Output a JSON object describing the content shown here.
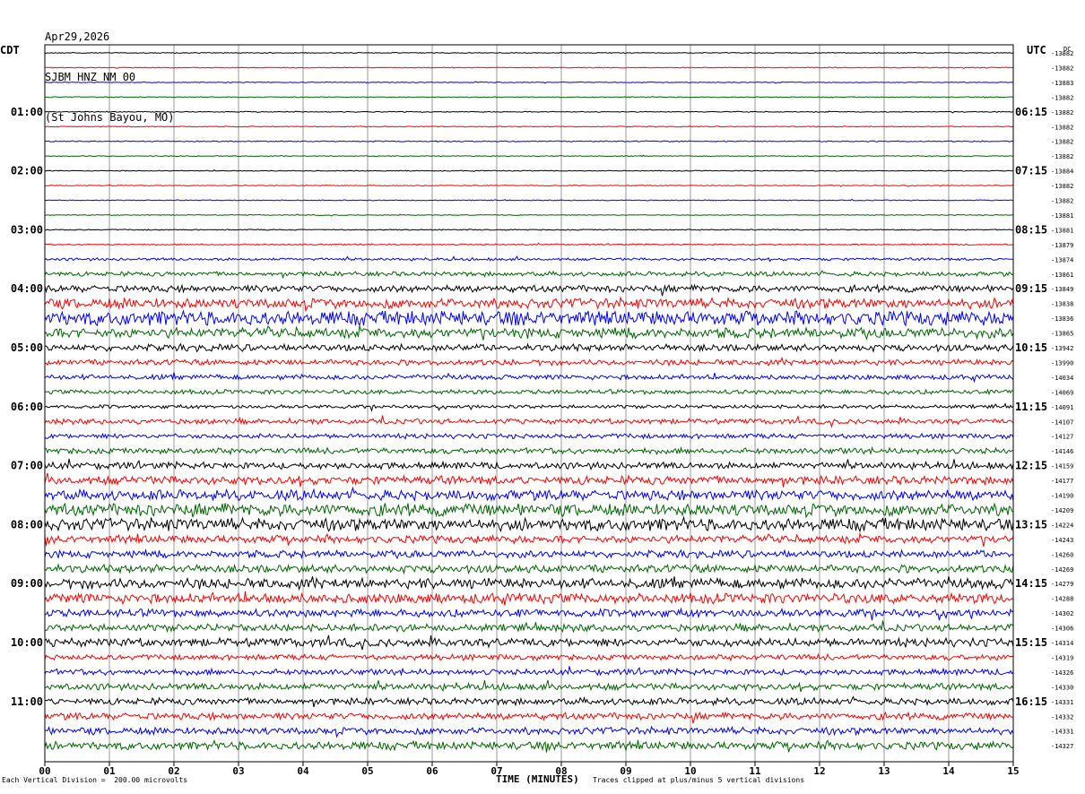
{
  "header": {
    "date": "Apr29,2026",
    "station": "SJBM HNZ NM 00",
    "location": "(St Johns Bayou, MO)"
  },
  "left_tz": "CDT",
  "right_tz": "UTC",
  "right_top_label": "DC",
  "footer": {
    "scale_note": "Each Vertical Division =  200.00 microvolts",
    "xlabel": "TIME (MINUTES)",
    "clip_note": "Traces clipped at plus/minus 5 vertical divisions"
  },
  "colors": {
    "black": "#000000",
    "red": "#ff0000",
    "blue": "#0000ff",
    "green": "#006600",
    "grid": "#808080"
  },
  "chart_data": {
    "type": "line",
    "title": "SJBM HNZ NM 00",
    "xlabel": "TIME (MINUTES)",
    "xlim": [
      0,
      15
    ],
    "x_ticks": [
      "00",
      "01",
      "02",
      "03",
      "04",
      "05",
      "06",
      "07",
      "08",
      "09",
      "10",
      "11",
      "12",
      "13",
      "14",
      "15"
    ],
    "left_time_labels": [
      "01:00",
      "02:00",
      "03:00",
      "04:00",
      "05:00",
      "06:00",
      "07:00",
      "08:00",
      "09:00",
      "10:00",
      "11:00"
    ],
    "right_time_labels": [
      "06:15",
      "07:15",
      "08:15",
      "09:15",
      "10:15",
      "11:15",
      "12:15",
      "13:15",
      "14:15",
      "15:15",
      "16:15"
    ],
    "trace_colors": [
      "black",
      "red",
      "blue",
      "green"
    ],
    "dc_offsets": [
      -13882,
      -13882,
      -13883,
      -13882,
      -13882,
      -13882,
      -13882,
      -13882,
      -13884,
      -13882,
      -13882,
      -13881,
      -13881,
      -13879,
      -13874,
      -13861,
      -13849,
      -13838,
      -13836,
      -13865,
      -13942,
      -13990,
      -14034,
      -14069,
      -14091,
      -14107,
      -14127,
      -14146,
      -14159,
      -14177,
      -14190,
      -14209,
      -14224,
      -14243,
      -14260,
      -14269,
      -14279,
      -14288,
      -14302,
      -14306,
      -14314,
      -14319,
      -14326,
      -14330,
      -14331,
      -14332,
      -14331,
      -14327
    ],
    "noise_levels": [
      0.4,
      0.4,
      0.4,
      0.4,
      0.4,
      0.4,
      0.5,
      0.4,
      0.4,
      0.4,
      0.4,
      0.4,
      0.5,
      0.6,
      1.2,
      2.0,
      3.0,
      4.5,
      6.5,
      4.5,
      3.0,
      2.5,
      2.2,
      2.0,
      1.6,
      2.3,
      2.2,
      2.6,
      3.0,
      3.8,
      4.5,
      5.5,
      5.5,
      3.5,
      3.2,
      3.5,
      4.5,
      4.5,
      3.5,
      3.2,
      3.8,
      2.5,
      2.6,
      3.0,
      3.0,
      3.0,
      3.2,
      3.6
    ]
  }
}
